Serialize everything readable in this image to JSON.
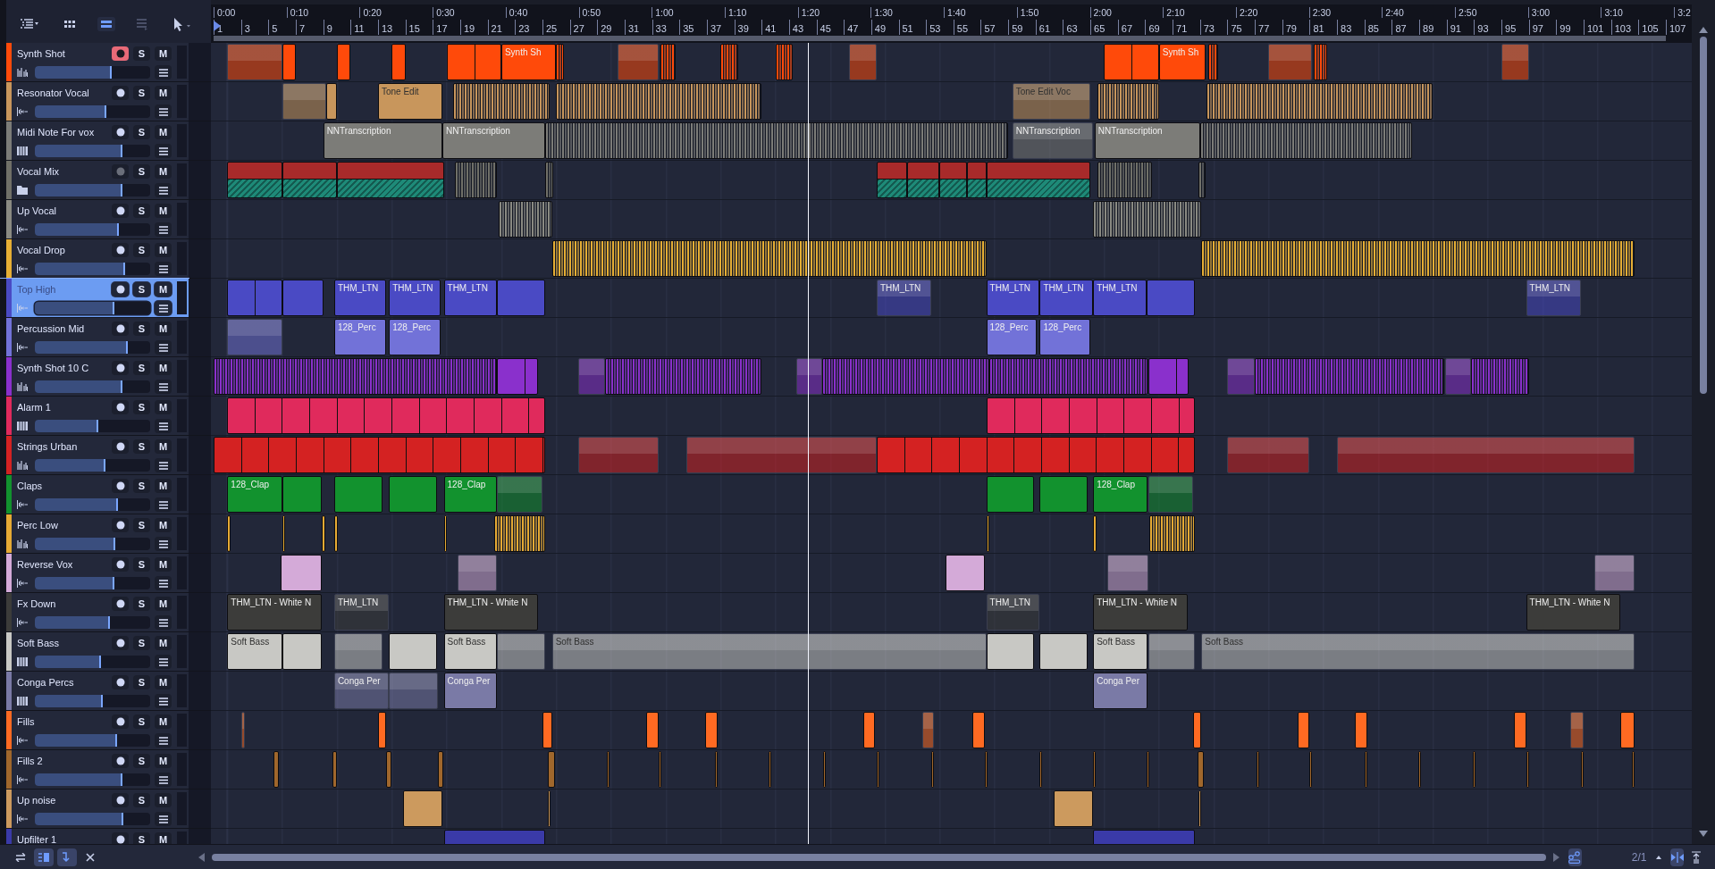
{
  "toolbar": [
    {
      "kind": "list-menu",
      "selected": false,
      "disabled": false
    },
    {
      "kind": "grid",
      "selected": false,
      "disabled": false
    },
    {
      "kind": "lanes",
      "selected": true,
      "disabled": false
    },
    {
      "kind": "stack",
      "selected": false,
      "disabled": true
    },
    {
      "kind": "pointer",
      "selected": false,
      "disabled": false
    }
  ],
  "ruler": {
    "time_labels": [
      "0:00",
      "0:10",
      "0:20",
      "0:30",
      "0:40",
      "0:50",
      "1:00",
      "1:10",
      "1:20",
      "1:30",
      "1:40",
      "1:50",
      "2:00",
      "2:10",
      "2:20",
      "2:30",
      "2:40",
      "2:50",
      "3:00",
      "3:10",
      "3:2"
    ],
    "bar_labels": [
      "1",
      "3",
      "5",
      "7",
      "9",
      "11",
      "13",
      "15",
      "17",
      "19",
      "21",
      "23",
      "25",
      "27",
      "29",
      "31",
      "33",
      "35",
      "37",
      "39",
      "41",
      "43",
      "45",
      "47",
      "49",
      "51",
      "53",
      "55",
      "57",
      "59",
      "61",
      "63",
      "65",
      "67",
      "69",
      "71",
      "73",
      "75",
      "77",
      "79",
      "81",
      "83",
      "85",
      "87",
      "89",
      "91",
      "93",
      "95",
      "97",
      "99",
      "101",
      "103",
      "105",
      "107"
    ]
  },
  "tracks": [
    {
      "name": "Synth Shot",
      "kind": "sampler",
      "color": "#ff4a0a",
      "selected": false,
      "armed": true,
      "solo": "S",
      "mute": "M",
      "level": 0.67,
      "clips": [
        {
          "kind": "ghost"
        },
        {
          "kind": "clip"
        },
        {
          "kind": "clip"
        },
        {
          "kind": "clip"
        },
        {
          "kind": "loop"
        },
        {
          "kind": "clip",
          "label": "Synth Sh"
        },
        {
          "kind": "slices"
        },
        {
          "kind": "ghost"
        },
        {
          "kind": "slices"
        },
        {
          "kind": "slices"
        },
        {
          "kind": "slices"
        },
        {
          "kind": "ghost"
        },
        {
          "kind": "loop"
        },
        {
          "kind": "clip",
          "label": "Synth Sh"
        },
        {
          "kind": "slices"
        },
        {
          "kind": "ghost"
        },
        {
          "kind": "slices"
        },
        {
          "kind": "ghost"
        }
      ]
    },
    {
      "name": "Resonator Vocal",
      "kind": "audio",
      "color": "#c8965c",
      "selected": false,
      "armed": false,
      "solo": "S",
      "mute": "M",
      "level": 0.62,
      "clips": [
        {
          "kind": "ghost"
        },
        {
          "kind": "clip"
        },
        {
          "kind": "clip",
          "label": "Tone Edit"
        },
        {
          "kind": "slices"
        },
        {
          "kind": "slices"
        },
        {
          "kind": "ghost",
          "label": "Tone Edit Voc"
        },
        {
          "kind": "slices"
        },
        {
          "kind": "slices"
        }
      ]
    },
    {
      "name": "Midi Note For vox",
      "kind": "instrument",
      "color": "#7c7c78",
      "selected": false,
      "armed": false,
      "solo": "S",
      "mute": "M",
      "level": 0.76,
      "clips": [
        {
          "kind": "clip",
          "label": "NNTranscription"
        },
        {
          "kind": "clip",
          "label": "NNTranscription"
        },
        {
          "kind": "slices"
        },
        {
          "kind": "ghost",
          "label": "NNTranscription"
        },
        {
          "kind": "clip",
          "label": "NNTranscription"
        },
        {
          "kind": "slices"
        }
      ]
    },
    {
      "name": "Vocal Mix",
      "kind": "folder",
      "color": "#707068",
      "selected": false,
      "armed": false,
      "solo": "S",
      "mute": "M",
      "level": 0.76,
      "clips": [
        {
          "kind": "folder"
        },
        {
          "kind": "folder"
        },
        {
          "kind": "folder"
        },
        {
          "kind": "slices"
        },
        {
          "kind": "slices"
        },
        {
          "kind": "folder"
        },
        {
          "kind": "folder"
        },
        {
          "kind": "folder"
        },
        {
          "kind": "folder"
        },
        {
          "kind": "folder"
        },
        {
          "kind": "slices"
        },
        {
          "kind": "slices"
        }
      ]
    },
    {
      "name": "Up Vocal",
      "kind": "audio",
      "color": "#8a8a82",
      "selected": false,
      "armed": false,
      "solo": "S",
      "mute": "M",
      "level": 0.73,
      "clips": [
        {
          "kind": "slices"
        },
        {
          "kind": "slices"
        }
      ]
    },
    {
      "name": "Vocal Drop",
      "kind": "audio",
      "color": "#e6ae34",
      "selected": false,
      "armed": false,
      "solo": "S",
      "mute": "M",
      "level": 0.78,
      "clips": [
        {
          "kind": "slices"
        },
        {
          "kind": "slices"
        }
      ]
    },
    {
      "name": "Top High",
      "kind": "audio",
      "color": "#4a4ac4",
      "selected": true,
      "armed": false,
      "solo": "S",
      "mute": "M",
      "level": 0.69,
      "clips": [
        {
          "kind": "loop"
        },
        {
          "kind": "clip"
        },
        {
          "kind": "clip",
          "label": "THM_LTN"
        },
        {
          "kind": "clip",
          "label": "THM_LTN"
        },
        {
          "kind": "clip",
          "label": "THM_LTN"
        },
        {
          "kind": "clip"
        },
        {
          "kind": "ghost",
          "label": "THM_LTN"
        },
        {
          "kind": "clip",
          "label": "THM_LTN"
        },
        {
          "kind": "clip",
          "label": "THM_LTN"
        },
        {
          "kind": "clip",
          "label": "THM_LTN"
        },
        {
          "kind": "clip"
        },
        {
          "kind": "ghost",
          "label": "THM_LTN"
        }
      ]
    },
    {
      "name": "Percussion Mid",
      "kind": "audio",
      "color": "#7272d8",
      "selected": false,
      "armed": false,
      "solo": "S",
      "mute": "M",
      "level": 0.81,
      "clips": [
        {
          "kind": "ghost"
        },
        {
          "kind": "clip",
          "label": "128_Perc"
        },
        {
          "kind": "clip",
          "label": "128_Perc"
        },
        {
          "kind": "clip",
          "label": "128_Perc"
        },
        {
          "kind": "clip",
          "label": "128_Perc"
        }
      ]
    },
    {
      "name": "Synth Shot 10 C",
      "kind": "sampler",
      "color": "#8a30cc",
      "selected": false,
      "armed": false,
      "solo": "S",
      "mute": "M",
      "level": 0.76,
      "clips": [
        {
          "kind": "slices"
        },
        {
          "kind": "loop"
        },
        {
          "kind": "ghost"
        },
        {
          "kind": "slices"
        },
        {
          "kind": "ghost"
        },
        {
          "kind": "slices"
        },
        {
          "kind": "slices"
        },
        {
          "kind": "loop"
        },
        {
          "kind": "ghost"
        },
        {
          "kind": "slices"
        },
        {
          "kind": "ghost"
        },
        {
          "kind": "slices"
        }
      ]
    },
    {
      "name": "Alarm 1",
      "kind": "instrument",
      "color": "#e02a5c",
      "selected": false,
      "armed": false,
      "solo": "S",
      "mute": "M",
      "level": 0.55,
      "clips": [
        {
          "kind": "loop"
        },
        {
          "kind": "loop"
        }
      ]
    },
    {
      "name": "Strings Urban",
      "kind": "sampler",
      "color": "#d42222",
      "selected": false,
      "armed": false,
      "solo": "S",
      "mute": "M",
      "level": 0.61,
      "clips": [
        {
          "kind": "loop"
        },
        {
          "kind": "ghost"
        },
        {
          "kind": "ghost"
        },
        {
          "kind": "loop"
        },
        {
          "kind": "ghost"
        },
        {
          "kind": "ghost"
        }
      ]
    },
    {
      "name": "Claps",
      "kind": "audio",
      "color": "#12922e",
      "selected": false,
      "armed": false,
      "solo": "S",
      "mute": "M",
      "level": 0.72,
      "clips": [
        {
          "kind": "clip",
          "label": "128_Clap"
        },
        {
          "kind": "clip"
        },
        {
          "kind": "clip"
        },
        {
          "kind": "clip"
        },
        {
          "kind": "clip",
          "label": "128_Clap"
        },
        {
          "kind": "ghost"
        },
        {
          "kind": "clip"
        },
        {
          "kind": "clip"
        },
        {
          "kind": "clip",
          "label": "128_Clap"
        },
        {
          "kind": "ghost"
        }
      ]
    },
    {
      "name": "Perc Low",
      "kind": "sampler",
      "color": "#e6aa34",
      "selected": false,
      "armed": false,
      "solo": "S",
      "mute": "M",
      "level": 0.7,
      "clips": [
        {
          "kind": "clip"
        },
        {
          "kind": "clip"
        },
        {
          "kind": "clip"
        },
        {
          "kind": "clip"
        },
        {
          "kind": "clip"
        },
        {
          "kind": "slices"
        },
        {
          "kind": "clip"
        },
        {
          "kind": "clip"
        },
        {
          "kind": "slices"
        }
      ]
    },
    {
      "name": "Reverse Vox",
      "kind": "audio",
      "color": "#d4aad8",
      "selected": false,
      "armed": false,
      "solo": "S",
      "mute": "M",
      "level": 0.69,
      "clips": [
        {
          "kind": "clip"
        },
        {
          "kind": "ghost"
        },
        {
          "kind": "clip"
        },
        {
          "kind": "ghost"
        },
        {
          "kind": "ghost"
        }
      ]
    },
    {
      "name": "Fx Down",
      "kind": "audio",
      "color": "#3c3c3a",
      "selected": false,
      "armed": false,
      "solo": "S",
      "mute": "M",
      "level": 0.65,
      "clips": [
        {
          "kind": "clip",
          "label": "THM_LTN - White N"
        },
        {
          "kind": "ghost",
          "label": "THM_LTN"
        },
        {
          "kind": "clip",
          "label": "THM_LTN - White N"
        },
        {
          "kind": "ghost",
          "label": "THM_LTN"
        },
        {
          "kind": "clip",
          "label": "THM_LTN - White N"
        },
        {
          "kind": "clip",
          "label": "THM_LTN - White N"
        }
      ]
    },
    {
      "name": "Soft Bass",
      "kind": "instrument",
      "color": "#c8c8c4",
      "selected": false,
      "armed": false,
      "solo": "S",
      "mute": "M",
      "level": 0.57,
      "clips": [
        {
          "kind": "clip",
          "label": "Soft Bass"
        },
        {
          "kind": "clip"
        },
        {
          "kind": "ghost"
        },
        {
          "kind": "clip"
        },
        {
          "kind": "clip",
          "label": "Soft Bass"
        },
        {
          "kind": "ghost"
        },
        {
          "kind": "ghost",
          "label": "Soft Bass"
        },
        {
          "kind": "clip"
        },
        {
          "kind": "clip"
        },
        {
          "kind": "clip",
          "label": "Soft Bass"
        },
        {
          "kind": "ghost"
        },
        {
          "kind": "ghost",
          "label": "Soft Bass"
        }
      ]
    },
    {
      "name": "Conga Percs",
      "kind": "instrument",
      "color": "#7a7aa6",
      "selected": false,
      "armed": false,
      "solo": "S",
      "mute": "M",
      "level": 0.59,
      "clips": [
        {
          "kind": "ghost",
          "label": "Conga Per"
        },
        {
          "kind": "ghost"
        },
        {
          "kind": "clip",
          "label": "Conga Per"
        },
        {
          "kind": "clip",
          "label": "Conga Per"
        }
      ]
    },
    {
      "name": "Fills",
      "kind": "audio",
      "color": "#ff6a22",
      "selected": false,
      "armed": false,
      "solo": "S",
      "mute": "M",
      "level": 0.71,
      "clips": [
        {
          "kind": "ghost"
        },
        {
          "kind": "clip"
        },
        {
          "kind": "clip"
        },
        {
          "kind": "clip"
        },
        {
          "kind": "clip"
        },
        {
          "kind": "clip"
        },
        {
          "kind": "ghost"
        },
        {
          "kind": "clip"
        },
        {
          "kind": "clip"
        },
        {
          "kind": "clip"
        },
        {
          "kind": "clip"
        },
        {
          "kind": "clip"
        },
        {
          "kind": "ghost"
        },
        {
          "kind": "clip"
        }
      ]
    },
    {
      "name": "Fills 2",
      "kind": "audio",
      "color": "#a0672c",
      "selected": false,
      "armed": false,
      "solo": "S",
      "mute": "M",
      "level": 0.76,
      "clips": [
        {
          "kind": "clip"
        },
        {
          "kind": "clip"
        },
        {
          "kind": "clip"
        },
        {
          "kind": "clip"
        },
        {
          "kind": "clip"
        },
        {
          "kind": "clip"
        },
        {
          "kind": "clip"
        },
        {
          "kind": "clip"
        },
        {
          "kind": "clip"
        },
        {
          "kind": "clip"
        },
        {
          "kind": "clip"
        },
        {
          "kind": "clip"
        },
        {
          "kind": "clip"
        },
        {
          "kind": "clip"
        },
        {
          "kind": "clip"
        },
        {
          "kind": "clip"
        },
        {
          "kind": "clip"
        },
        {
          "kind": "clip"
        },
        {
          "kind": "clip"
        },
        {
          "kind": "clip"
        },
        {
          "kind": "clip"
        },
        {
          "kind": "clip"
        },
        {
          "kind": "clip"
        },
        {
          "kind": "clip"
        },
        {
          "kind": "clip"
        }
      ]
    },
    {
      "name": "Up noise",
      "kind": "audio",
      "color": "#cc9a5e",
      "selected": false,
      "armed": false,
      "solo": "S",
      "mute": "M",
      "level": 0.77,
      "clips": [
        {
          "kind": "clip"
        },
        {
          "kind": "clip"
        },
        {
          "kind": "clip"
        },
        {
          "kind": "clip"
        }
      ]
    },
    {
      "name": "Upfilter 1",
      "kind": "audio",
      "color": "#3a3aa8",
      "selected": false,
      "armed": false,
      "solo": "S",
      "mute": "M",
      "clips": [
        {
          "kind": "clip"
        },
        {
          "kind": "clip"
        }
      ]
    }
  ],
  "bottom_left": [
    {
      "kind": "swap",
      "selected": false
    },
    {
      "kind": "list-view",
      "selected": true
    },
    {
      "kind": "wrap",
      "selected": true
    },
    {
      "kind": "close",
      "selected": false
    }
  ],
  "bottom_right": [
    {
      "kind": "link",
      "selected": true
    },
    {
      "kind": "ratio",
      "text": "2/1"
    },
    {
      "kind": "caret-up",
      "selected": false
    },
    {
      "kind": "fit",
      "selected": true
    },
    {
      "kind": "pin",
      "selected": false
    }
  ]
}
